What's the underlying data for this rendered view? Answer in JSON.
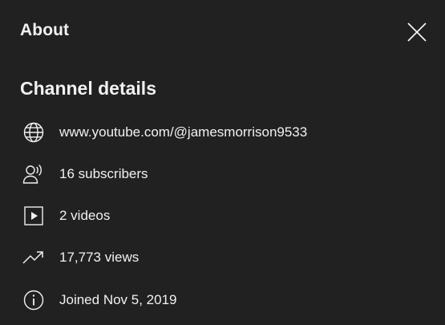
{
  "dialog": {
    "title": "About",
    "close_icon": "close-icon"
  },
  "channel_details": {
    "heading": "Channel details",
    "rows": [
      {
        "icon": "globe-icon",
        "text": "www.youtube.com/@jamesmorrison9533"
      },
      {
        "icon": "subscribers-icon",
        "text": "16 subscribers"
      },
      {
        "icon": "video-icon",
        "text": "2 videos"
      },
      {
        "icon": "trending-icon",
        "text": "17,773 views"
      },
      {
        "icon": "info-icon",
        "text": "Joined Nov 5, 2019"
      }
    ]
  }
}
